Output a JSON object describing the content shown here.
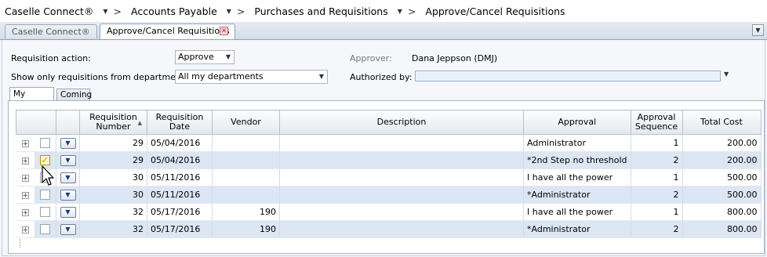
{
  "breadcrumb": {
    "items": [
      "Caselle Connect®",
      "Accounts Payable",
      "Purchases and Requisitions",
      "Approve/Cancel Requisitions"
    ],
    "separator": ">"
  },
  "tabs": {
    "items": [
      {
        "label": "Caselle Connect®",
        "active": false
      },
      {
        "label": "Approve/Cancel Requisitions",
        "active": true
      }
    ],
    "close_glyph": "✕",
    "menu_glyph": "▼"
  },
  "form": {
    "requisition_action_label": "Requisition action:",
    "requisition_action_value": "Approve",
    "department_label": "Show only requisitions from department:",
    "department_value": "All my departments",
    "approver_label": "Approver:",
    "approver_value": "Dana Jeppson (DMJ)",
    "authorized_by_label": "Authorized by:",
    "authorized_by_value": ""
  },
  "subtabs": [
    "My Queue",
    "Coming"
  ],
  "grid": {
    "headers": {
      "req_number": "Requisition Number",
      "req_date": "Requisition Date",
      "vendor": "Vendor",
      "description": "Description",
      "approval": "Approval",
      "approval_sequence": "Approval Sequence",
      "total_cost": "Total Cost"
    },
    "rows": [
      {
        "req_number": "29",
        "req_date": "05/04/2016",
        "vendor": "",
        "description": "",
        "approval": "Administrator",
        "sequence": "1",
        "total_cost": "200.00",
        "checked": false
      },
      {
        "req_number": "29",
        "req_date": "05/04/2016",
        "vendor": "",
        "description": "",
        "approval": "*2nd Step no threshold",
        "sequence": "2",
        "total_cost": "200.00",
        "checked": true
      },
      {
        "req_number": "30",
        "req_date": "05/11/2016",
        "vendor": "",
        "description": "",
        "approval": "I have all the power",
        "sequence": "1",
        "total_cost": "500.00",
        "checked": false
      },
      {
        "req_number": "30",
        "req_date": "05/11/2016",
        "vendor": "",
        "description": "",
        "approval": "*Administrator",
        "sequence": "2",
        "total_cost": "500.00",
        "checked": false
      },
      {
        "req_number": "32",
        "req_date": "05/17/2016",
        "vendor": "190",
        "description": "",
        "approval": "I have all the power",
        "sequence": "1",
        "total_cost": "800.00",
        "checked": false
      },
      {
        "req_number": "32",
        "req_date": "05/17/2016",
        "vendor": "190",
        "description": "",
        "approval": "*Administrator",
        "sequence": "2",
        "total_cost": "800.00",
        "checked": false
      }
    ]
  },
  "colors": {
    "row_alt": "#dce6f4",
    "checked_accent": "#c79000",
    "dropdown_arrow": "#123a8a"
  }
}
